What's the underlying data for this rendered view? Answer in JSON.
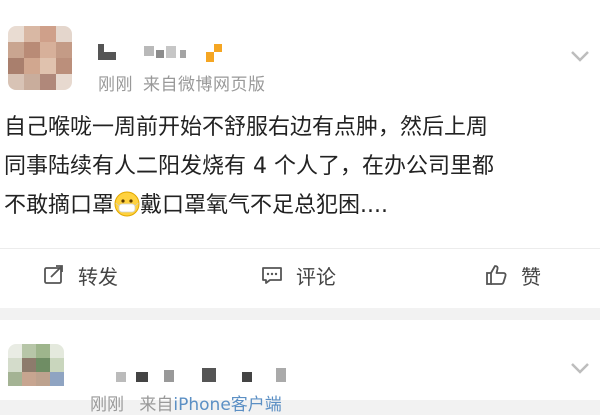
{
  "post": {
    "time": "刚刚",
    "source": "来自微博网页版",
    "lines": [
      "自己喉咙一周前开始不舒服右边有点肿，然后上周",
      "同事陆续有人二阳发烧有 4 个人了，在办公司里都",
      "不敢摘口罩",
      "戴口罩氧气不足总犯困...."
    ],
    "emoji": "mask-face",
    "actions": {
      "forward": "转发",
      "comment": "评论",
      "like": "赞"
    }
  },
  "post2": {
    "time": "刚刚",
    "source_prefix": "来自",
    "source_link": "iPhone客户端"
  },
  "colors": {
    "background": "#f2f2f2",
    "card": "#ffffff",
    "meta_text": "#999999",
    "link": "#5b8fc4",
    "name_accent": "#f5a623"
  }
}
